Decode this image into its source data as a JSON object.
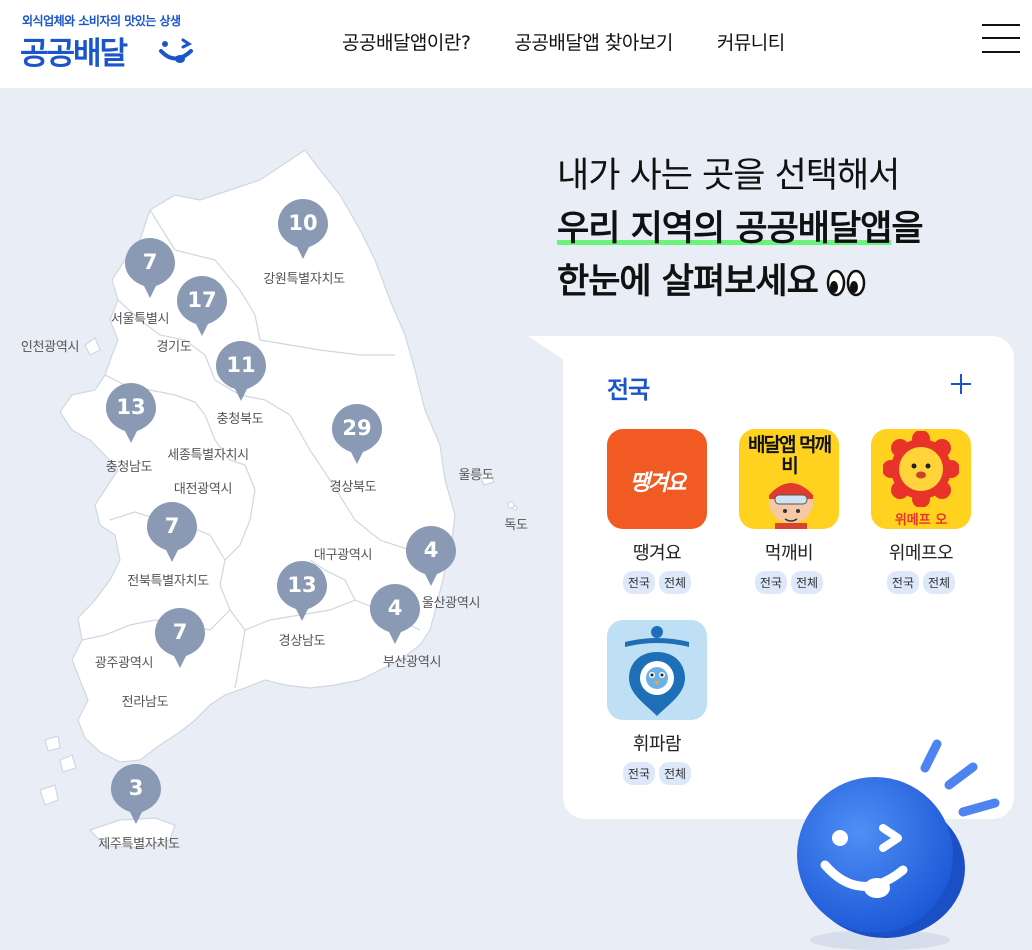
{
  "header": {
    "tagline": "외식업체와 소비자의 맛있는 상생",
    "logo_title": "공공배달",
    "nav": [
      "공공배달앱이란?",
      "공공배달앱 찾아보기",
      "커뮤니티"
    ]
  },
  "headline": {
    "line1": "내가 사는 곳을 선택해서",
    "line2": "우리 지역의 공공배달앱을",
    "line2_highlight": "우리 지역의 공공배달앱",
    "line2_suffix": "을",
    "line3": "한눈에 살펴보세요"
  },
  "map": {
    "regions": [
      {
        "name": "강원특별자치도",
        "count": "10"
      },
      {
        "name": "서울특별시",
        "count": "7"
      },
      {
        "name": "경기도",
        "count": "17"
      },
      {
        "name": "인천광역시"
      },
      {
        "name": "충청북도",
        "count": "11"
      },
      {
        "name": "충청남도",
        "count": "13"
      },
      {
        "name": "세종특별자치시"
      },
      {
        "name": "대전광역시"
      },
      {
        "name": "경상북도",
        "count": "29"
      },
      {
        "name": "울릉도"
      },
      {
        "name": "독도"
      },
      {
        "name": "대구광역시"
      },
      {
        "name": "전북특별자치도",
        "count": "7"
      },
      {
        "name": "울산광역시",
        "count": "4"
      },
      {
        "name": "경상남도",
        "count": "13"
      },
      {
        "name": "부산광역시",
        "count": "4"
      },
      {
        "name": "광주광역시",
        "count": "7"
      },
      {
        "name": "전라남도"
      },
      {
        "name": "제주특별자치도",
        "count": "3"
      }
    ],
    "pin_color": "#8a9ab4"
  },
  "card": {
    "title": "전국",
    "apps": [
      {
        "name": "땡겨요",
        "tags": [
          "전국",
          "전체"
        ],
        "icon_text": "땡겨요",
        "color": "#f15a22"
      },
      {
        "name": "먹깨비",
        "tags": [
          "전국",
          "전체"
        ],
        "icon_text": "배달앱 먹깨비",
        "color": "#ffd21f"
      },
      {
        "name": "위메프오",
        "tags": [
          "전국",
          "전체"
        ],
        "icon_text": "위메프 오",
        "color": "#ffd21f"
      },
      {
        "name": "휘파람",
        "tags": [
          "전국",
          "전체"
        ],
        "color": "#bfe0f4"
      }
    ]
  },
  "colors": {
    "brand_blue": "#1a56c9",
    "highlight_green": "#6bf27a",
    "background": "#e9eef6"
  }
}
